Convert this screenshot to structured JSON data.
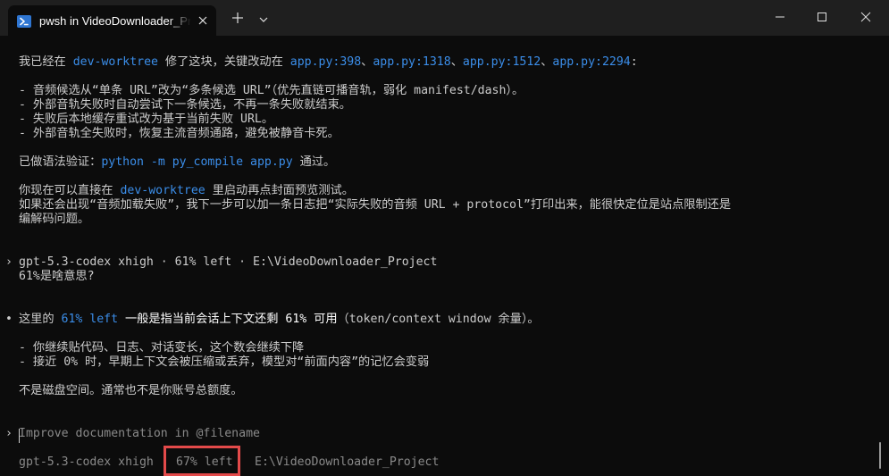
{
  "window": {
    "tab_title": "pwsh in VideoDownloader_Project",
    "icons": {
      "shell": "powershell-icon",
      "close_tab": "close-icon",
      "new_tab": "plus-icon",
      "dropdown": "chevron-down-icon",
      "minimize": "minimize-icon",
      "maximize": "maximize-icon",
      "close": "close-icon"
    }
  },
  "colors": {
    "background": "#0c0c0c",
    "titlebar": "#1f1f1f",
    "text": "#cccccc",
    "highlight": "#3b8eea",
    "dim": "#8a8a8a",
    "annotation_box": "#e34a4a"
  },
  "terminal": {
    "msg1": {
      "p1": "我已经在 ",
      "c1": "dev-worktree",
      "p2": " 修了这块，关键改动在 ",
      "c2": "app.py:398",
      "p3": "、",
      "c3": "app.py:1318",
      "p4": "、",
      "c4": "app.py:1512",
      "p5": "、",
      "c5": "app.py:2294",
      "p6": ":"
    },
    "bullets1": [
      "- 音频候选从“单条 URL”改为“多条候选 URL”（优先直链可播音轨，弱化 manifest/dash）。",
      "- 外部音轨失败时自动尝试下一条候选，不再一条失败就结束。",
      "- 失败后本地缓存重试改为基于当前失败 URL。",
      "- 外部音轨全失败时，恢复主流音频通路，避免被静音卡死。"
    ],
    "verify": {
      "p1": "已做语法验证：",
      "c1": "python -m py_compile app.py",
      "p2": " 通过。"
    },
    "next": {
      "p1": "你现在可以直接在 ",
      "c1": "dev-worktree",
      "p2": " 里启动再点封面预览测试。"
    },
    "more": [
      "如果还会出现“音频加载失败”，我下一步可以加一条日志把“实际失败的音频 URL + protocol”打印出来，能很快定位是站点限制还是",
      "编解码问题。"
    ],
    "prompt_symbol": "›",
    "status_line": "gpt-5.3-codex xhigh · 61% left · E:\\VideoDownloader_Project",
    "user_question": "61%是啥意思?",
    "bullet_dot": "•",
    "answer": {
      "p1": "这里的 ",
      "c1": "61% left",
      "p2": " 一般是指当前会话上下文还剩 ",
      "c2": "61%",
      "p3": " 可用",
      "p4": "（token/context window 余量）。"
    },
    "bullets2": [
      "- 你继续贴代码、日志、对话变长，这个数会继续下降",
      "- 接近 0% 时，早期上下文会被压缩或丢弃，模型对“前面内容”的记忆会变弱"
    ],
    "final": "不是磁盘空间。通常也不是你账号总额度。",
    "input_placeholder": "Improve documentation in @filename",
    "footer": {
      "model": "gpt-5.3-codex xhigh",
      "left": "67% left",
      "path": "E:\\VideoDownloader_Project"
    }
  }
}
